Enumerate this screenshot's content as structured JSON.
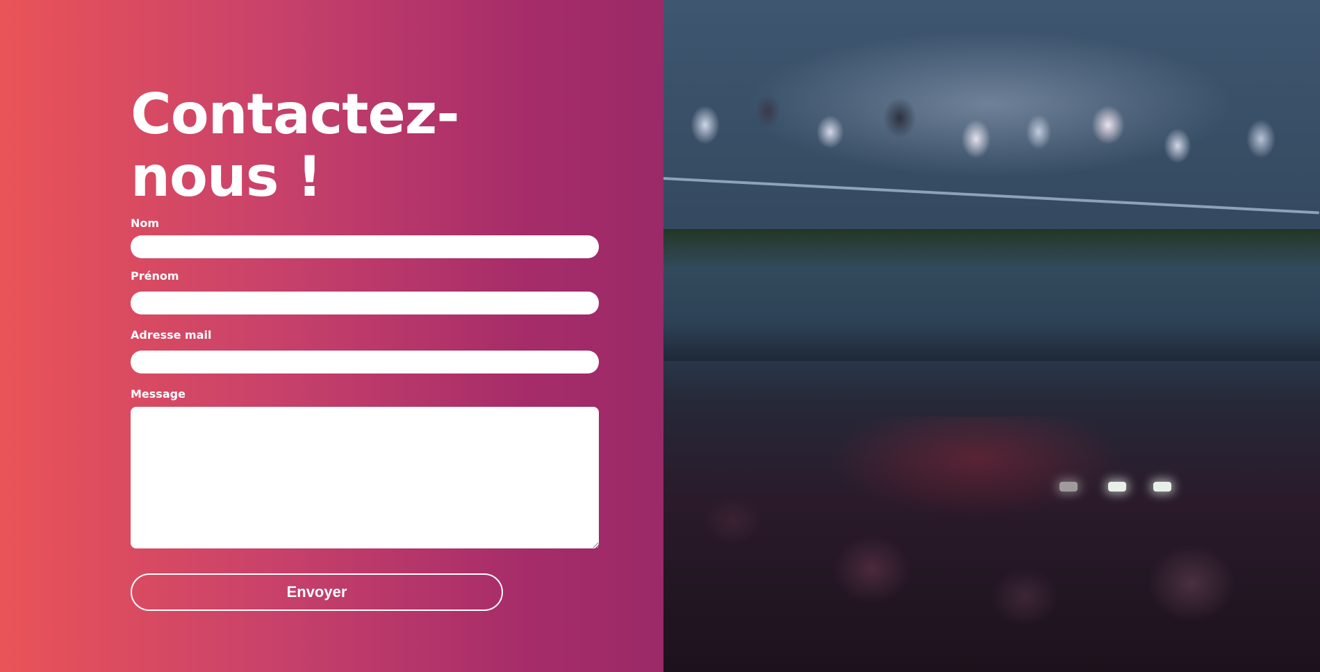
{
  "contact_form": {
    "title": "Contactez-nous !",
    "fields": {
      "nom_label": "Nom",
      "nom_value": "",
      "prenom_label": "Prénom",
      "prenom_value": "",
      "email_label": "Adresse mail",
      "email_value": "",
      "message_label": "Message",
      "message_value": ""
    },
    "submit_label": "Envoyer"
  },
  "hero_image": {
    "icon": "concert-crowd-photo"
  },
  "colors": {
    "gradient_start": "#ea5458",
    "gradient_end": "#9b2a68",
    "input_background": "#ffffff",
    "text": "#ffffff"
  }
}
